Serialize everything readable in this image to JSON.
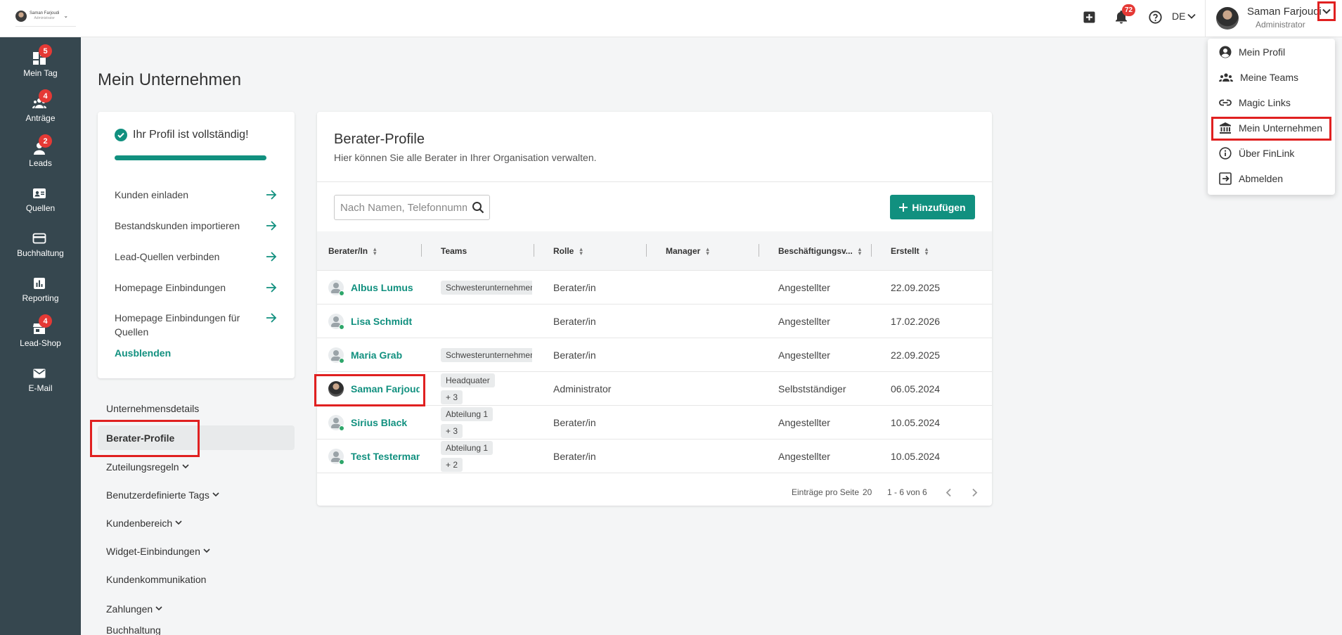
{
  "header": {
    "brand_name": "Saman Farjoudi",
    "brand_role": "Administrator",
    "notification_count": "72",
    "language": "DE",
    "user_name": "Saman Farjoudi",
    "user_role": "Administrator"
  },
  "sidebar": {
    "items": [
      {
        "label": "Mein Tag",
        "icon": "dashboard-icon",
        "badge": "5"
      },
      {
        "label": "Anträge",
        "icon": "group-icon",
        "badge": "4"
      },
      {
        "label": "Leads",
        "icon": "person-icon",
        "badge": "2"
      },
      {
        "label": "Quellen",
        "icon": "contact-card-icon",
        "badge": ""
      },
      {
        "label": "Buchhaltung",
        "icon": "credit-card-icon",
        "badge": ""
      },
      {
        "label": "Reporting",
        "icon": "chart-icon",
        "badge": ""
      },
      {
        "label": "Lead-Shop",
        "icon": "store-icon",
        "badge": "4"
      },
      {
        "label": "E-Mail",
        "icon": "mail-icon",
        "badge": ""
      }
    ]
  },
  "page": {
    "title": "Mein Unternehmen"
  },
  "profile_card": {
    "title": "Ihr Profil ist vollständig!",
    "progress": 1.0,
    "steps": [
      "Kunden einladen",
      "Bestandskunden importieren",
      "Lead-Quellen verbinden",
      "Homepage Einbindungen",
      "Homepage Einbindungen für Quellen"
    ],
    "hide_label": "Ausblenden"
  },
  "side_menu": [
    {
      "label": "Unternehmensdetails",
      "expandable": false
    },
    {
      "label": "Berater-Profile",
      "expandable": false
    },
    {
      "label": "Zuteilungsregeln",
      "expandable": true
    },
    {
      "label": "Benutzerdefinierte Tags",
      "expandable": true
    },
    {
      "label": "Kundenbereich",
      "expandable": true
    },
    {
      "label": "Widget-Einbindungen",
      "expandable": true
    },
    {
      "label": "Kundenkommunikation",
      "expandable": false
    },
    {
      "label": "Zahlungen",
      "expandable": true
    },
    {
      "label": "Buchhaltung",
      "expandable": false
    }
  ],
  "main": {
    "title": "Berater-Profile",
    "subtitle": "Hier können Sie alle Berater in Ihrer Organisation verwalten.",
    "search_placeholder": "Nach Namen, Telefonnummer oder E-Mail suchen",
    "add_label": "Hinzufügen",
    "columns": [
      "Berater/In",
      "Teams",
      "Rolle",
      "Manager",
      "Beschäftigungsv...",
      "Erstellt"
    ],
    "rows": [
      {
        "name": "Albus Lumus",
        "teams": [
          "Schwesterunternehmen"
        ],
        "role": "Berater/in",
        "manager": "",
        "employment": "Angestellter",
        "created": "22.09.2025",
        "photo": false
      },
      {
        "name": "Lisa Schmidt",
        "teams": [],
        "role": "Berater/in",
        "manager": "",
        "employment": "Angestellter",
        "created": "17.02.2026",
        "photo": false
      },
      {
        "name": "Maria Grab",
        "teams": [
          "Schwesterunternehmen"
        ],
        "role": "Berater/in",
        "manager": "",
        "employment": "Angestellter",
        "created": "22.09.2025",
        "photo": false
      },
      {
        "name": "Saman Farjoudi",
        "teams": [
          "Headquater",
          "+ 3"
        ],
        "role": "Administrator",
        "manager": "",
        "employment": "Selbstständiger",
        "created": "06.05.2024",
        "photo": true
      },
      {
        "name": "Sirius Black",
        "teams": [
          "Abteilung 1",
          "+ 3"
        ],
        "role": "Berater/in",
        "manager": "",
        "employment": "Angestellter",
        "created": "10.05.2024",
        "photo": false
      },
      {
        "name": "Test Testerman",
        "teams": [
          "Abteilung 1",
          "+ 2"
        ],
        "role": "Berater/in",
        "manager": "",
        "employment": "Angestellter",
        "created": "10.05.2024",
        "photo": false
      }
    ],
    "footer": {
      "per_page_label": "Einträge pro Seite",
      "per_page_value": "20",
      "range": "1 - 6 von 6"
    }
  },
  "dropdown": {
    "items": [
      {
        "label": "Mein Profil",
        "icon": "account-circle-icon"
      },
      {
        "label": "Meine Teams",
        "icon": "groups-icon"
      },
      {
        "label": "Magic Links",
        "icon": "link-icon"
      },
      {
        "label": "Mein Unternehmen",
        "icon": "bank-icon"
      },
      {
        "label": "Über FinLink",
        "icon": "info-icon"
      },
      {
        "label": "Abmelden",
        "icon": "logout-icon"
      }
    ]
  },
  "colors": {
    "accent": "#11907f",
    "sidebar": "#36474f",
    "badge": "#e53935",
    "highlight": "#e02020"
  }
}
